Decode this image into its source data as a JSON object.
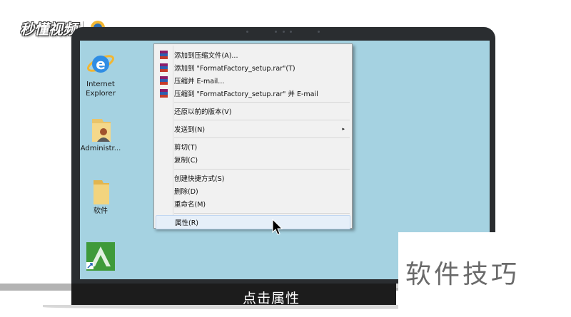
{
  "watermark": {
    "brand": "秒懂视频",
    "logo": "brand-logo"
  },
  "desktop": {
    "icons": [
      {
        "label": "Internet Explorer",
        "icon": "internet-explorer-icon"
      },
      {
        "label": "Administr...",
        "icon": "user-folder-icon"
      },
      {
        "label": "软件",
        "icon": "folder-icon"
      },
      {
        "label": "",
        "icon": "shortcut-app-icon"
      }
    ]
  },
  "context_menu": {
    "items": [
      {
        "label": "添加到压缩文件(A)...",
        "icon": "winrar-icon"
      },
      {
        "label": "添加到 \"FormatFactory_setup.rar\"(T)",
        "icon": "winrar-icon"
      },
      {
        "label": "压缩并 E-mail...",
        "icon": "winrar-icon"
      },
      {
        "label": "压缩到 \"FormatFactory_setup.rar\" 并 E-mail",
        "icon": "winrar-icon"
      },
      {
        "label": "还原以前的版本(V)"
      },
      {
        "label": "发送到(N)",
        "submenu_arrow": "▸"
      },
      {
        "label": "剪切(T)"
      },
      {
        "label": "复制(C)"
      },
      {
        "label": "创建快捷方式(S)"
      },
      {
        "label": "删除(D)"
      },
      {
        "label": "重命名(M)"
      },
      {
        "label": "属性(R)",
        "highlighted": true
      }
    ]
  },
  "caption": "点击属性",
  "overlay_title": "软件技巧",
  "colors": {
    "desktop_bg": "#a5d2e1",
    "menu_bg": "#f1f1f1",
    "menu_highlight": "#e6eff9",
    "caption_bg": "#1c1c1c"
  }
}
